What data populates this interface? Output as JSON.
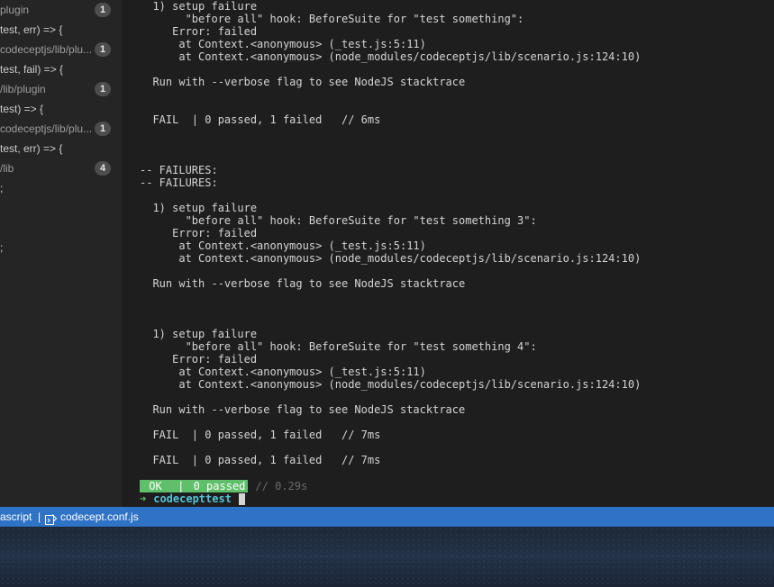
{
  "sidebar": {
    "items": [
      {
        "text": "plugin",
        "badge": "1",
        "kind": "path"
      },
      {
        "text": "test, err) => {",
        "badge": "",
        "kind": "code"
      },
      {
        "text": "codeceptjs/lib/plu...",
        "badge": "1",
        "kind": "path"
      },
      {
        "text": "test, fail) => {",
        "badge": "",
        "kind": "code"
      },
      {
        "text": "/lib/plugin",
        "badge": "1",
        "kind": "path"
      },
      {
        "text": "test) => {",
        "badge": "",
        "kind": "code"
      },
      {
        "text": "codeceptjs/lib/plu...",
        "badge": "1",
        "kind": "path"
      },
      {
        "text": "test, err) => {",
        "badge": "",
        "kind": "code"
      },
      {
        "text": "/lib",
        "badge": "4",
        "kind": "path"
      },
      {
        "text": ";",
        "badge": "",
        "kind": "code"
      },
      {
        "text": "",
        "badge": "",
        "kind": "code"
      },
      {
        "text": "",
        "badge": "",
        "kind": "code"
      },
      {
        "text": ";",
        "badge": "",
        "kind": "code"
      }
    ]
  },
  "terminal": {
    "lines": [
      "  1) setup failure",
      "       \"before all\" hook: BeforeSuite for \"test something\":",
      "     Error: failed",
      "      at Context.<anonymous> (_test.js:5:11)",
      "      at Context.<anonymous> (node_modules/codeceptjs/lib/scenario.js:124:10)",
      "",
      "  Run with --verbose flag to see NodeJS stacktrace",
      "",
      "",
      "  FAIL  | 0 passed, 1 failed   // 6ms",
      "",
      "",
      "",
      "-- FAILURES:",
      "-- FAILURES:",
      "",
      "  1) setup failure",
      "       \"before all\" hook: BeforeSuite for \"test something 3\":",
      "     Error: failed",
      "      at Context.<anonymous> (_test.js:5:11)",
      "      at Context.<anonymous> (node_modules/codeceptjs/lib/scenario.js:124:10)",
      "",
      "  Run with --verbose flag to see NodeJS stacktrace",
      "",
      "",
      "",
      "  1) setup failure",
      "       \"before all\" hook: BeforeSuite for \"test something 4\":",
      "     Error: failed",
      "      at Context.<anonymous> (_test.js:5:11)",
      "      at Context.<anonymous> (node_modules/codeceptjs/lib/scenario.js:124:10)",
      "",
      "  Run with --verbose flag to see NodeJS stacktrace",
      "",
      "  FAIL  | 0 passed, 1 failed   // 7ms",
      "",
      "  FAIL  | 0 passed, 1 failed   // 7ms"
    ],
    "summary": {
      "ok_label": " OK ",
      "separator": " | ",
      "passed_label": "0 passed",
      "time": "// 0.29s"
    },
    "prompt": {
      "arrow": "➜",
      "directory": "codecepttest"
    }
  },
  "statusbar": {
    "language": "ascript",
    "separator": "|",
    "file_icon": "file-code-icon",
    "file_name": "codecept.conf.js"
  },
  "colors": {
    "statusbar": "#2f73c6",
    "ok_green": "#5fbf6a",
    "prompt_cyan": "#56c2d6"
  }
}
